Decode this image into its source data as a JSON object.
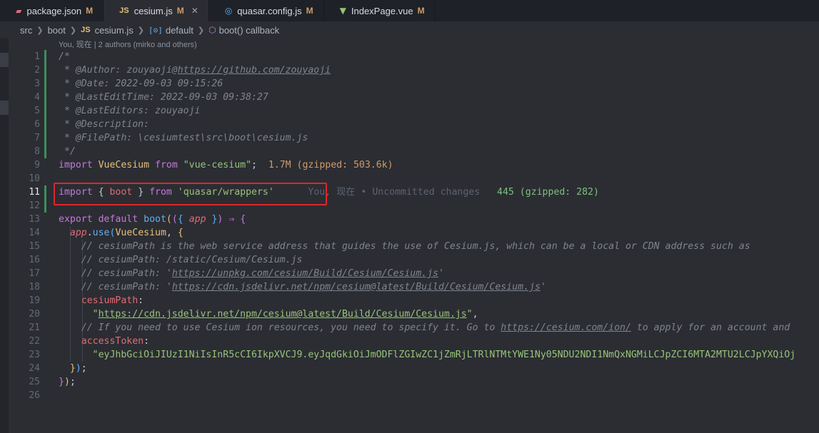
{
  "tabs": [
    {
      "icon": "package-json-icon",
      "label": "package.json",
      "status": "M",
      "active": false
    },
    {
      "icon": "javascript-file-icon",
      "label": "cesium.js",
      "status": "M",
      "active": true
    },
    {
      "icon": "quasar-icon",
      "label": "quasar.config.js",
      "status": "M",
      "active": false
    },
    {
      "icon": "vue-icon",
      "label": "IndexPage.vue",
      "status": "M",
      "active": false
    }
  ],
  "breadcrumb": {
    "src": "src",
    "boot": "boot",
    "js_badge": "JS",
    "file": "cesium.js",
    "symbol": "default",
    "callback": "boot() callback"
  },
  "blame": {
    "header": "You, 现在 | 2 authors (mirko and others)",
    "inline": "You, 现在 • Uncommitted changes"
  },
  "import_costs": {
    "vue_cesium": "1.7M (gzipped: 503.6k)",
    "quasar_wrappers": "445 (gzipped: 282)"
  },
  "code": {
    "l1": "/*",
    "l2_a": " * @Author: zouyaoji@",
    "l2_b": "https://github.com/zouyaoji",
    "l3": " * @Date: 2022-09-03 09:15:26",
    "l4": " * @LastEditTime: 2022-09-03 09:38:27",
    "l5": " * @LastEditors: zouyaoji",
    "l6": " * @Description:",
    "l7": " * @FilePath: \\cesiumtest\\src\\boot\\cesium.js",
    "l8": " */",
    "l9_import": "import",
    "l9_name": "VueCesium",
    "l9_from": "from",
    "l9_str": "\"vue-cesium\"",
    "l11_import": "import",
    "l11_name": "boot",
    "l11_from": "from",
    "l11_str": "'quasar/wrappers'",
    "l13_export": "export",
    "l13_default": "default",
    "l13_boot": "boot",
    "l13_app": "app",
    "l14_app": "app",
    "l14_use": "use",
    "l14_vc": "VueCesium",
    "l15": "// cesiumPath is the web service address that guides the use of Cesium.js, which can be a local or CDN address such as",
    "l16": "// cesiumPath: /static/Cesium/Cesium.js",
    "l17_a": "// cesiumPath: '",
    "l17_b": "https://unpkg.com/cesium/Build/Cesium/Cesium.js",
    "l17_c": "'",
    "l18_a": "// cesiumPath: '",
    "l18_b": "https://cdn.jsdelivr.net/npm/cesium@latest/Build/Cesium/Cesium.js",
    "l18_c": "'",
    "l19": "cesiumPath",
    "l20_b": "https://cdn.jsdelivr.net/npm/cesium@latest/Build/Cesium/Cesium.js",
    "l21_a": "// If you need to use Cesium ion resources, you need to specify it. Go to ",
    "l21_b": "https://cesium.com/ion/",
    "l21_c": " to apply for an account and",
    "l22": "accessToken",
    "l23": "\"eyJhbGciOiJIUzI1NiIsInR5cCI6IkpXVCJ9.eyJqdGkiOiJmODFlZGIwZC1jZmRjLTRlNTMtYWE1Ny05NDU2NDI1NmQxNGMiLCJpZCI6MTA2MTU2LCJpYXQiOj"
  },
  "line_numbers": [
    "1",
    "2",
    "3",
    "4",
    "5",
    "6",
    "7",
    "8",
    "9",
    "10",
    "11",
    "12",
    "13",
    "14",
    "15",
    "16",
    "17",
    "18",
    "19",
    "20",
    "21",
    "22",
    "23",
    "24",
    "25",
    "26"
  ]
}
